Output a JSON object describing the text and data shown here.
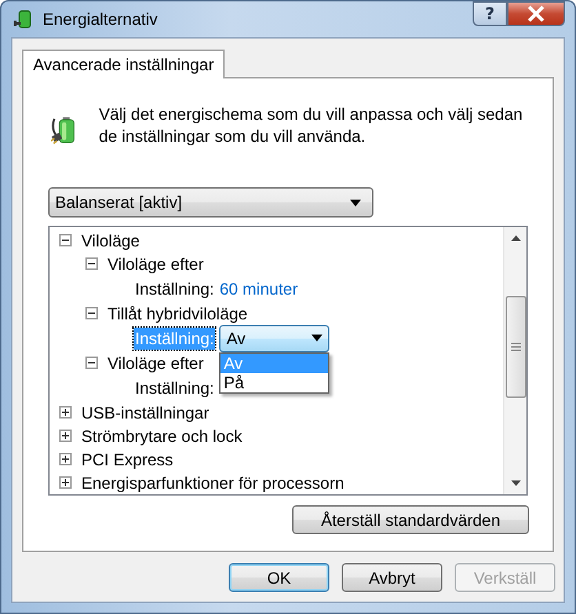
{
  "window": {
    "title": "Energialternativ",
    "help_button": "?"
  },
  "tabs": [
    {
      "label": "Avancerade inställningar",
      "selected": true
    }
  ],
  "intro": "Välj det energischema som du vill anpassa och välj sedan de inställningar som du vill använda.",
  "plan_dropdown": {
    "value": "Balanserat [aktiv]"
  },
  "tree": [
    {
      "label": "Viloläge",
      "expanded": true,
      "children": [
        {
          "label": "Viloläge efter",
          "expanded": true,
          "setting": {
            "kind": "link",
            "label": "Inställning:",
            "value": "60 minuter",
            "selected": false
          }
        },
        {
          "label": "Tillåt hybridviloläge",
          "expanded": true,
          "setting": {
            "kind": "combo",
            "label": "Inställning:",
            "value": "Av",
            "selected": true,
            "open": true,
            "options": [
              {
                "label": "Av",
                "selected": true
              },
              {
                "label": "På",
                "selected": false
              }
            ]
          }
        },
        {
          "label": "Viloläge efter",
          "expanded": true,
          "setting": {
            "kind": "link",
            "label": "Inställning:",
            "selected": false
          }
        }
      ]
    },
    {
      "label": "USB-inställningar",
      "expanded": false
    },
    {
      "label": "Strömbrytare och lock",
      "expanded": false
    },
    {
      "label": "PCI Express",
      "expanded": false
    },
    {
      "label": "Energisparfunktioner för processorn",
      "expanded": false
    }
  ],
  "restore_button": "Återställ standardvärden",
  "buttons": [
    {
      "label": "OK",
      "default": true,
      "disabled": false
    },
    {
      "label": "Avbryt",
      "default": false,
      "disabled": false
    },
    {
      "label": "Verkställ",
      "default": false,
      "disabled": true
    }
  ]
}
